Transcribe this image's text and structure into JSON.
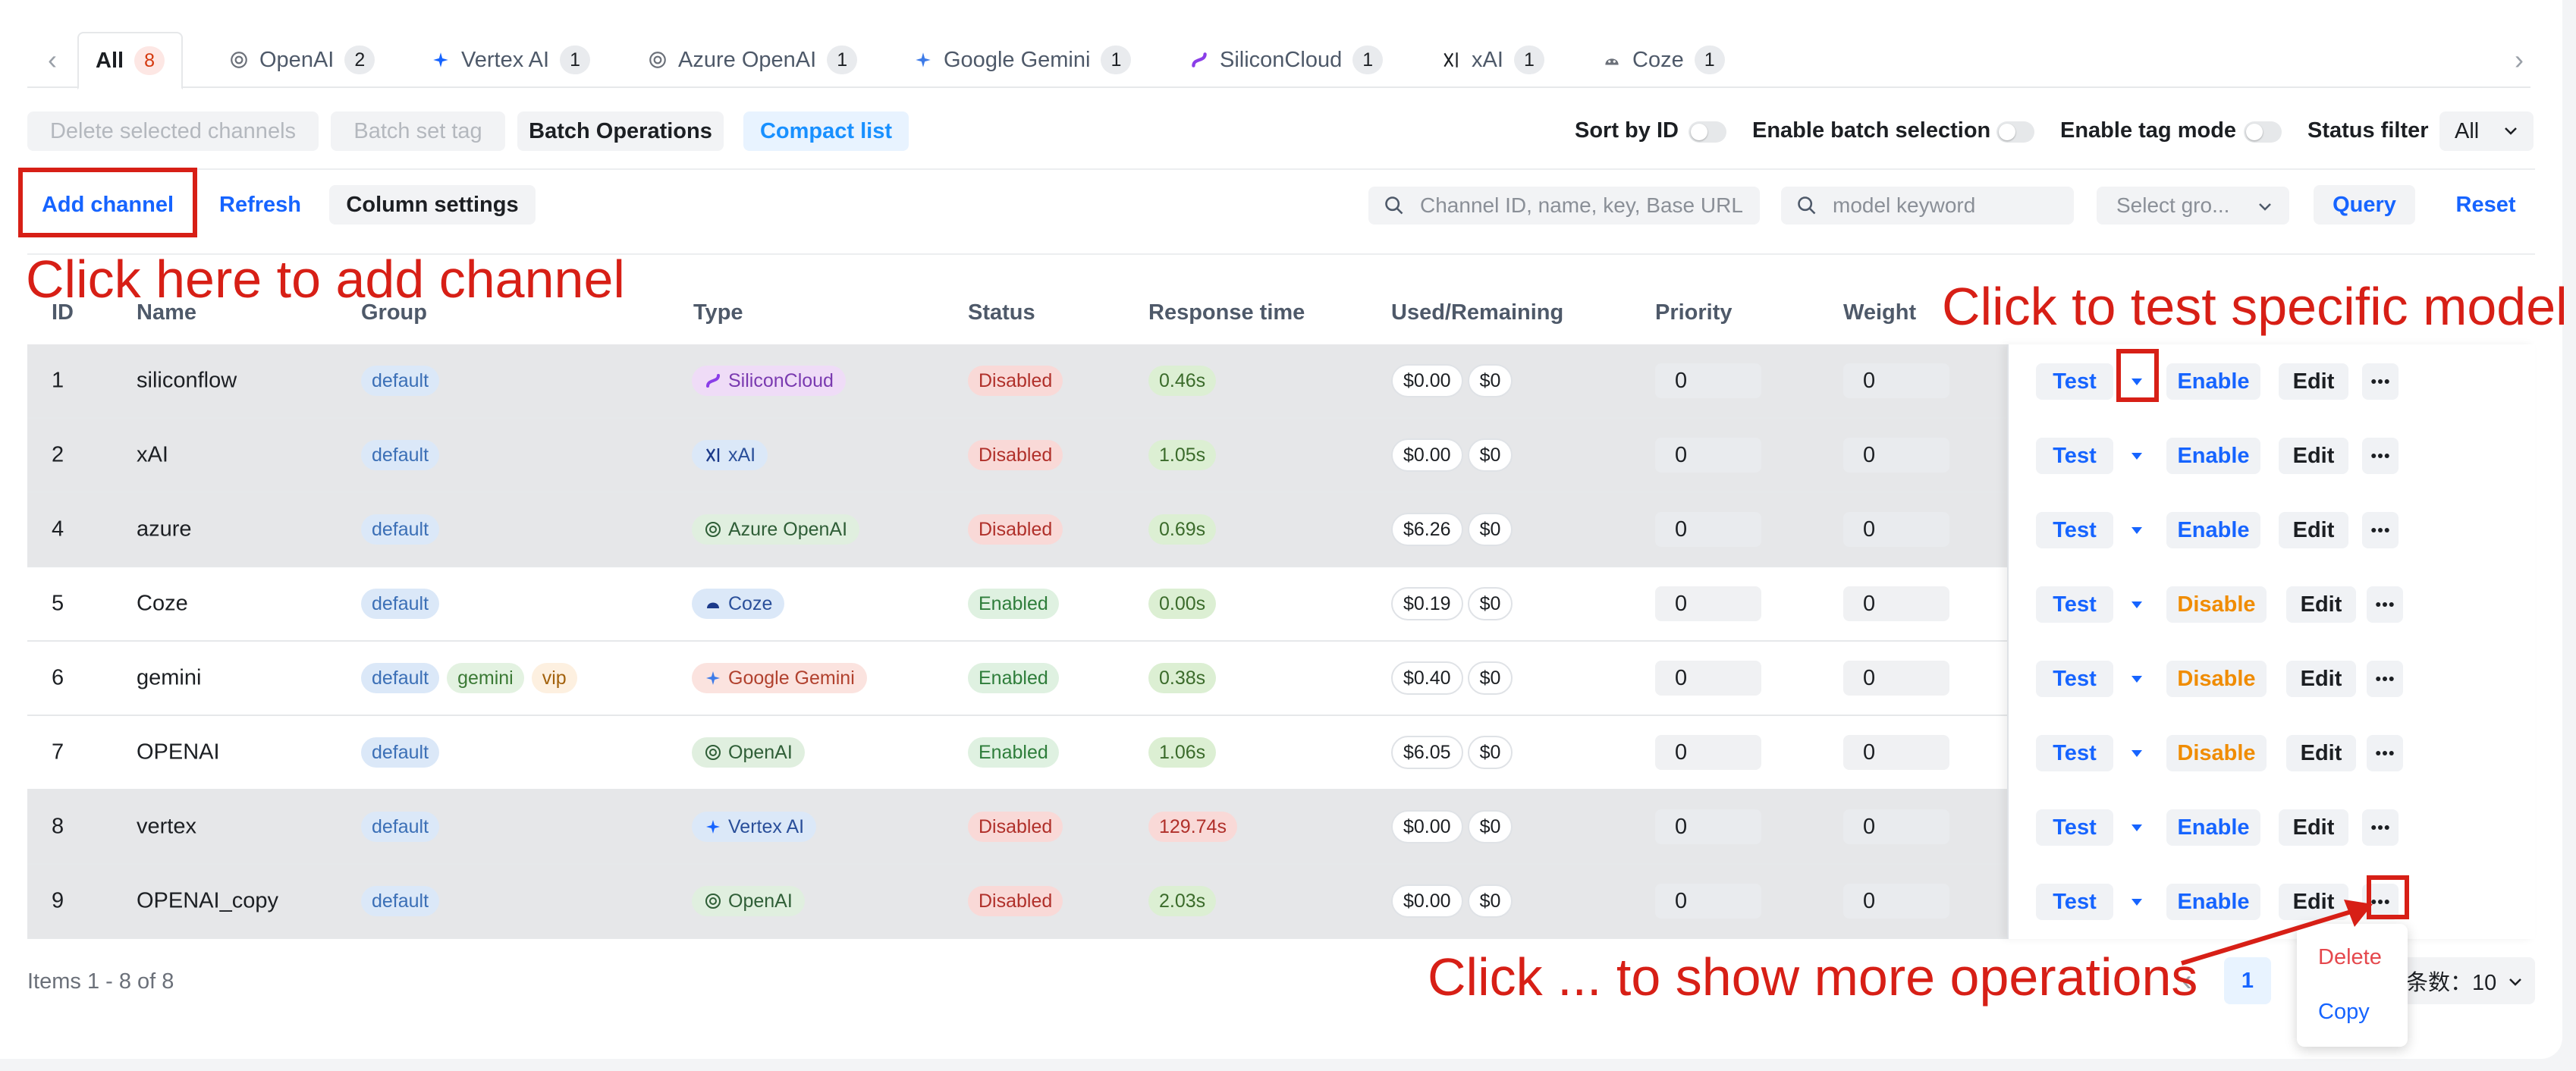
{
  "tabs": [
    {
      "label": "All",
      "count": "8",
      "icon": "all"
    },
    {
      "label": "OpenAI",
      "count": "2",
      "icon": "openai-icon"
    },
    {
      "label": "Vertex AI",
      "count": "1",
      "icon": "vertex-icon"
    },
    {
      "label": "Azure OpenAI",
      "count": "1",
      "icon": "openai-icon"
    },
    {
      "label": "Google Gemini",
      "count": "1",
      "icon": "gemini-icon"
    },
    {
      "label": "SiliconCloud",
      "count": "1",
      "icon": "siliconcloud-icon"
    },
    {
      "label": "xAI",
      "count": "1",
      "icon": "xai-icon"
    },
    {
      "label": "Coze",
      "count": "1",
      "icon": "coze-icon"
    }
  ],
  "toolbar1": {
    "delete_selected": "Delete selected channels",
    "batch_set_tag": "Batch set tag",
    "batch_operations": "Batch Operations",
    "compact_list": "Compact list",
    "sort_by_id": "Sort by ID",
    "enable_batch_selection": "Enable batch selection",
    "enable_tag_mode": "Enable tag mode",
    "status_filter": "Status filter",
    "status_value": "All"
  },
  "toolbar2": {
    "add_channel": "Add channel",
    "refresh": "Refresh",
    "column_settings": "Column settings",
    "search_placeholder": "Channel ID, name, key, Base URL",
    "model_placeholder": "model keyword",
    "group_placeholder": "Select gro...",
    "query": "Query",
    "reset": "Reset"
  },
  "columns": [
    "ID",
    "Name",
    "Group",
    "Type",
    "Status",
    "Response time",
    "Used/Remaining",
    "Priority",
    "Weight"
  ],
  "rows": [
    {
      "id": "1",
      "name": "siliconflow",
      "groups": [
        "default"
      ],
      "type": "SiliconCloud",
      "type_class": "t-sc",
      "status": "Disabled",
      "response": "0.46s",
      "resp_ok": true,
      "used": "$0.00",
      "remaining": "$0",
      "priority": "0",
      "weight": "0",
      "toggle": "Enable"
    },
    {
      "id": "2",
      "name": "xAI",
      "groups": [
        "default"
      ],
      "type": "xAI",
      "type_class": "t-xai",
      "status": "Disabled",
      "response": "1.05s",
      "resp_ok": true,
      "used": "$0.00",
      "remaining": "$0",
      "priority": "0",
      "weight": "0",
      "toggle": "Enable"
    },
    {
      "id": "4",
      "name": "azure",
      "groups": [
        "default"
      ],
      "type": "Azure OpenAI",
      "type_class": "t-az",
      "status": "Disabled",
      "response": "0.69s",
      "resp_ok": true,
      "used": "$6.26",
      "remaining": "$0",
      "priority": "0",
      "weight": "0",
      "toggle": "Enable"
    },
    {
      "id": "5",
      "name": "Coze",
      "groups": [
        "default"
      ],
      "type": "Coze",
      "type_class": "t-coze",
      "status": "Enabled",
      "response": "0.00s",
      "resp_ok": true,
      "used": "$0.19",
      "remaining": "$0",
      "priority": "0",
      "weight": "0",
      "toggle": "Disable"
    },
    {
      "id": "6",
      "name": "gemini",
      "groups": [
        "default",
        "gemini",
        "vip"
      ],
      "type": "Google Gemini",
      "type_class": "t-gg",
      "status": "Enabled",
      "response": "0.38s",
      "resp_ok": true,
      "used": "$0.40",
      "remaining": "$0",
      "priority": "0",
      "weight": "0",
      "toggle": "Disable"
    },
    {
      "id": "7",
      "name": "OPENAI",
      "groups": [
        "default"
      ],
      "type": "OpenAI",
      "type_class": "t-oa",
      "status": "Enabled",
      "response": "1.06s",
      "resp_ok": true,
      "used": "$6.05",
      "remaining": "$0",
      "priority": "0",
      "weight": "0",
      "toggle": "Disable"
    },
    {
      "id": "8",
      "name": "vertex",
      "groups": [
        "default"
      ],
      "type": "Vertex AI",
      "type_class": "t-vx",
      "status": "Disabled",
      "response": "129.74s",
      "resp_ok": false,
      "used": "$0.00",
      "remaining": "$0",
      "priority": "0",
      "weight": "0",
      "toggle": "Enable"
    },
    {
      "id": "9",
      "name": "OPENAI_copy",
      "groups": [
        "default"
      ],
      "type": "OpenAI",
      "type_class": "t-oa",
      "status": "Disabled",
      "response": "2.03s",
      "resp_ok": true,
      "used": "$0.00",
      "remaining": "$0",
      "priority": "0",
      "weight": "0",
      "toggle": "Enable"
    }
  ],
  "row_ops": {
    "test": "Test",
    "edit": "Edit",
    "more": "..."
  },
  "footer": {
    "items_text": "Items 1 - 8 of 8",
    "page": "1",
    "page_size": "条数：10"
  },
  "more_menu": {
    "delete": "Delete",
    "copy": "Copy"
  },
  "annotations": {
    "add_channel": "Click here to add channel",
    "test_model": "Click to test specific model",
    "more_ops": "Click ... to show more operations"
  },
  "colors": {
    "accent": "#1664ff",
    "annotation": "#d71f16",
    "warning": "#f08c00"
  }
}
